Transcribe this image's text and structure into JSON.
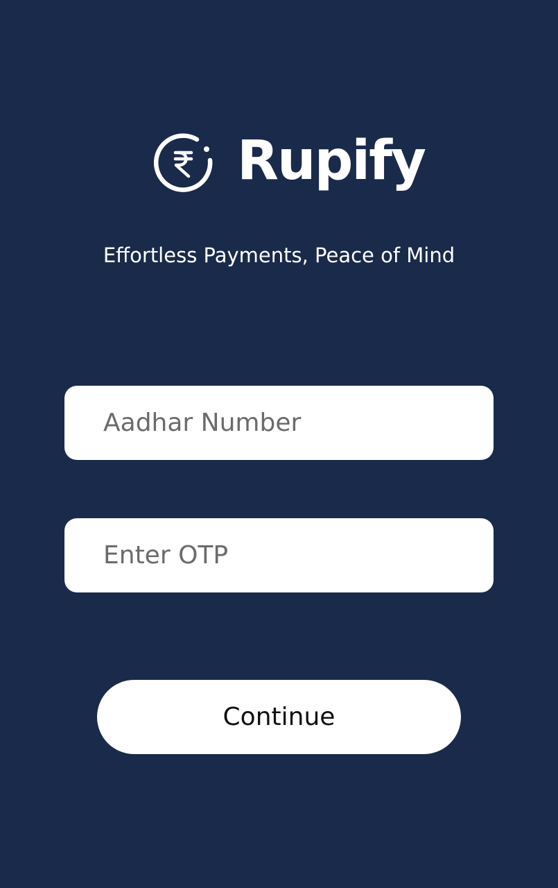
{
  "app": {
    "brand_name": "Rupify",
    "logo_icon": "rupee-circle-icon",
    "tagline": "Effortless Payments, Peace of Mind"
  },
  "form": {
    "aadhar": {
      "placeholder": "Aadhar Number",
      "value": ""
    },
    "otp": {
      "placeholder": "Enter OTP",
      "value": ""
    },
    "continue_label": "Continue"
  },
  "colors": {
    "background": "#1a2a4a",
    "surface": "#ffffff",
    "placeholder": "#6b6b6b",
    "button_text": "#111111"
  }
}
